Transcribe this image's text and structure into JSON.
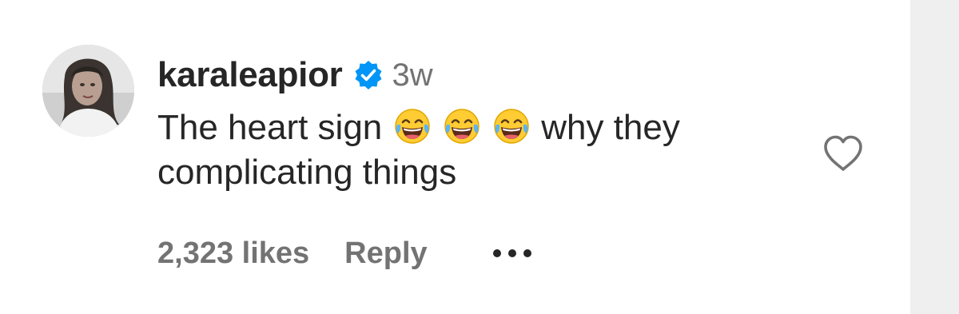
{
  "comment": {
    "username": "karaleapior",
    "verified": true,
    "time_ago": "3w",
    "text_before": "The heart sign",
    "emojis": [
      "face-with-tears-of-joy",
      "face-with-tears-of-joy",
      "face-with-tears-of-joy"
    ],
    "text_after": "why they complicating things",
    "likes": "2,323 likes",
    "reply_label": "Reply",
    "more_icon": "ellipsis-icon",
    "like_icon": "heart-outline-icon"
  },
  "colors": {
    "text_primary": "#262626",
    "text_secondary": "#737373",
    "verified_blue": "#0095f6",
    "scroll_track": "#efefef"
  }
}
